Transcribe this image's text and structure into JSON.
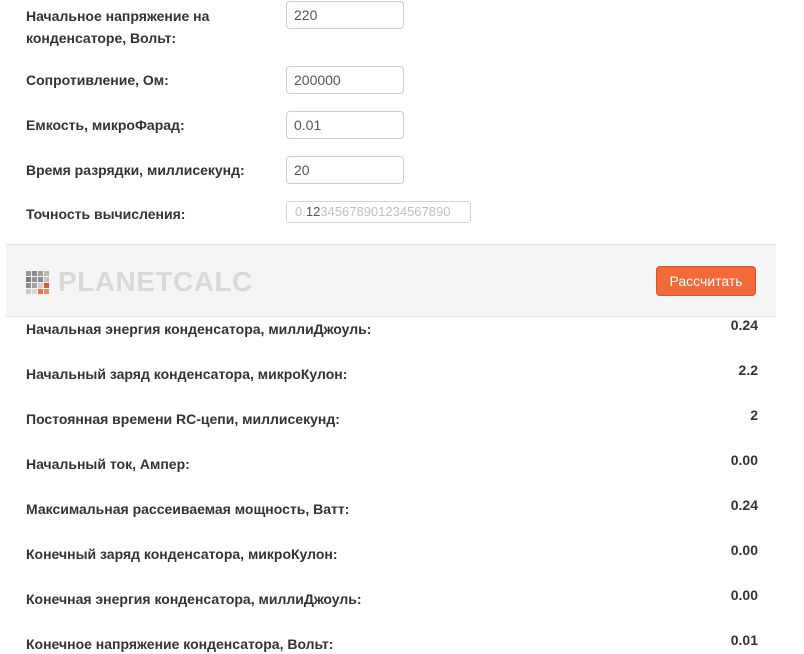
{
  "inputs": {
    "voltage": {
      "label": "Начальное напряжение на конденсаторе, Вольт:",
      "value": "220"
    },
    "resistance": {
      "label": "Сопротивление, Ом:",
      "value": "200000"
    },
    "capacitance": {
      "label": "Емкость, микроФарад:",
      "value": "0.01"
    },
    "time": {
      "label": "Время разрядки, миллисекунд:",
      "value": "20"
    },
    "precision": {
      "label": "Точность вычисления:",
      "prefix": "0.",
      "selected": "12",
      "rest": "345678901234567890"
    }
  },
  "toolbar": {
    "logo_text": "PLANETCALC",
    "calculate_label": "Рассчитать",
    "accent_color": "#f26a3a"
  },
  "results": [
    {
      "label": "Начальная энергия конденсатора, миллиДжоуль:",
      "value": "0.24"
    },
    {
      "label": "Начальный заряд конденсатора, микроКулон:",
      "value": "2.2"
    },
    {
      "label": "Постоянная времени RC-цепи, миллисекунд:",
      "value": "2"
    },
    {
      "label": "Начальный ток, Ампер:",
      "value": "0.00"
    },
    {
      "label": "Максимальная рассеиваемая мощность, Ватт:",
      "value": "0.24"
    },
    {
      "label": "Конечный заряд конденсатора, микроКулон:",
      "value": "0.00"
    },
    {
      "label": "Конечная энергия конденсатора, миллиДжоуль:",
      "value": "0.00"
    },
    {
      "label": "Конечное напряжение конденсатора, Вольт:",
      "value": "0.01"
    }
  ]
}
